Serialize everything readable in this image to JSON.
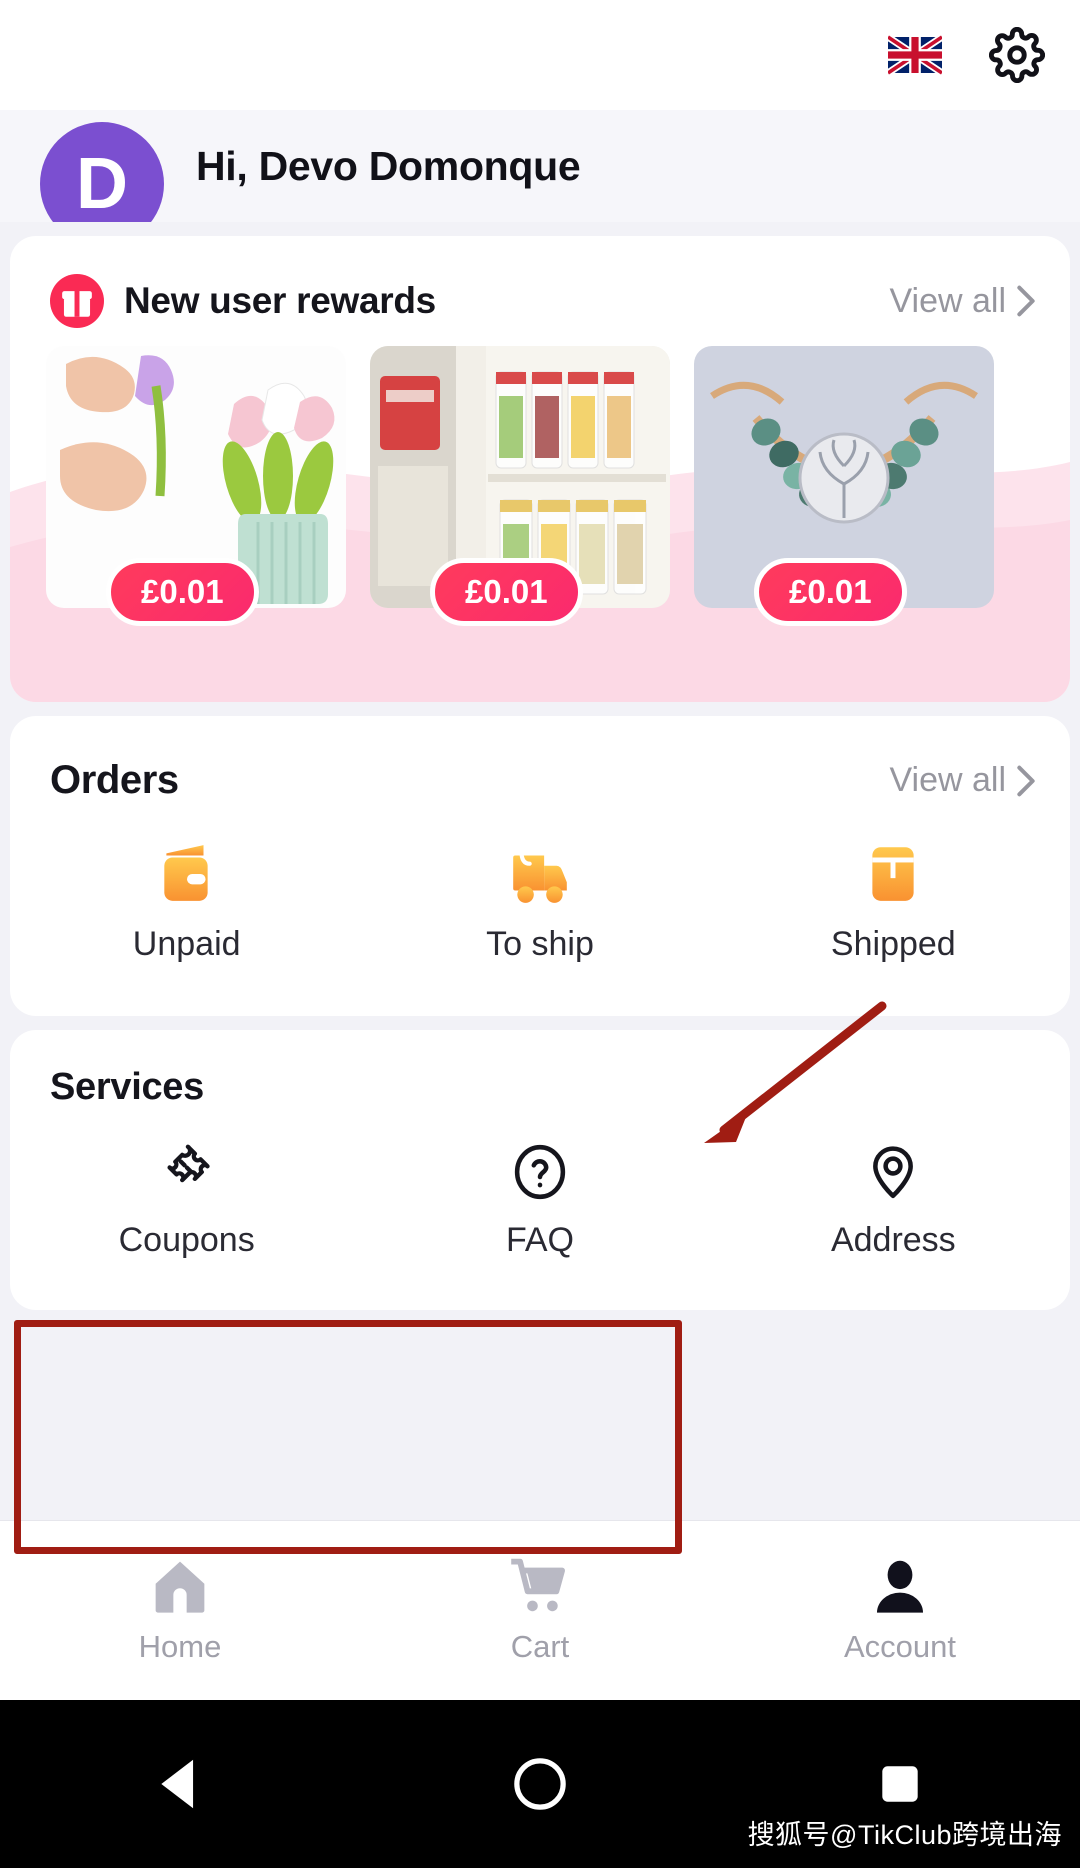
{
  "statusbar": {
    "flag_label": "United Kingdom",
    "settings_label": "Settings"
  },
  "profile": {
    "avatar_initial": "D",
    "greeting": "Hi, Devo Domonque"
  },
  "rewards": {
    "title": "New user rewards",
    "view_all": "View all",
    "icon": "gift-icon",
    "products": [
      {
        "price": "£0.01",
        "alt": "Soap rose flower bouquet"
      },
      {
        "price": "£0.01",
        "alt": "Fridge storage jar bags"
      },
      {
        "price": "£0.01",
        "alt": "Turquoise tree of life bracelet"
      }
    ]
  },
  "orders": {
    "title": "Orders",
    "view_all": "View all",
    "items": [
      {
        "label": "Unpaid",
        "icon": "wallet-icon"
      },
      {
        "label": "To ship",
        "icon": "truck-icon"
      },
      {
        "label": "Shipped",
        "icon": "package-icon"
      }
    ]
  },
  "services": {
    "title": "Services",
    "items": [
      {
        "label": "Coupons",
        "icon": "ticket-icon"
      },
      {
        "label": "FAQ",
        "icon": "question-circle-icon"
      },
      {
        "label": "Address",
        "icon": "location-pin-icon"
      }
    ]
  },
  "tabbar": {
    "tabs": [
      {
        "label": "Home",
        "icon": "home-icon",
        "active": false
      },
      {
        "label": "Cart",
        "icon": "cart-icon",
        "active": false
      },
      {
        "label": "Account",
        "icon": "person-icon",
        "active": true
      }
    ]
  },
  "navbar": {
    "back": "Back",
    "home": "Home",
    "recents": "Recents",
    "watermark": "搜狐号@TikClub跨境出海"
  },
  "colors": {
    "accent_pink": "#fa2a6e",
    "accent_red": "#ff3b5c",
    "order_icon": "#ffa726",
    "avatar_purple": "#7b4fd0",
    "annotation_red": "#a01d13",
    "muted_text": "#96969e"
  }
}
